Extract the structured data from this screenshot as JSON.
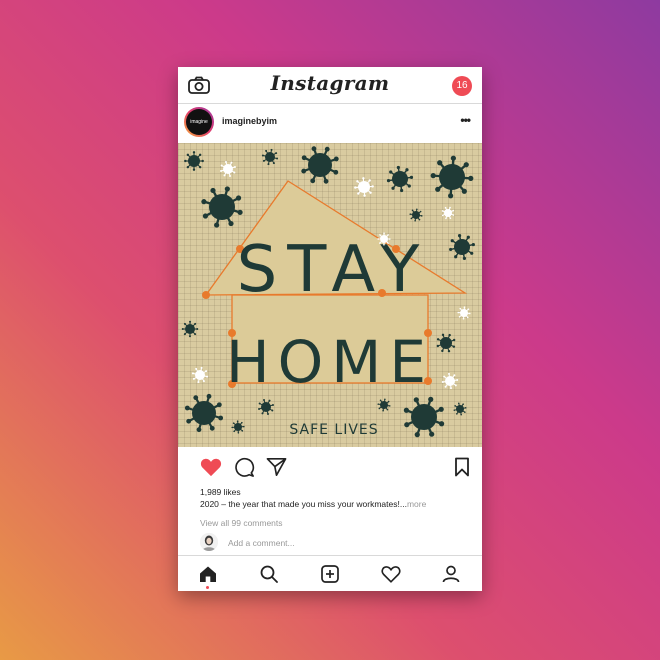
{
  "app": {
    "name": "Instagram",
    "notification_count": "16"
  },
  "post": {
    "username": "imaginebyim",
    "avatar_text": "imagine",
    "artwork": {
      "line1": "STAY",
      "line2": "HOME",
      "footer": "SAFE LIVES"
    },
    "likes": "1,989 likes",
    "caption": "2020 – the year that made you miss your workmates!...",
    "caption_more": "more",
    "view_comments": "View all 99 comments",
    "add_comment_placeholder": "Add a comment..."
  },
  "colors": {
    "like_heart": "#ef4b55",
    "badge": "#ef4b55",
    "artwork_bg": "#d9cba0",
    "artwork_text": "#1f3a36",
    "artwork_accent": "#e87a2c"
  },
  "icons": {
    "top_left": "camera-icon",
    "post_menu": "more-dots-icon",
    "like": "heart-icon",
    "comment": "comment-icon",
    "share": "send-icon",
    "save": "bookmark-icon",
    "nav": [
      "home-icon",
      "search-icon",
      "add-post-icon",
      "heart-icon",
      "profile-icon"
    ]
  }
}
